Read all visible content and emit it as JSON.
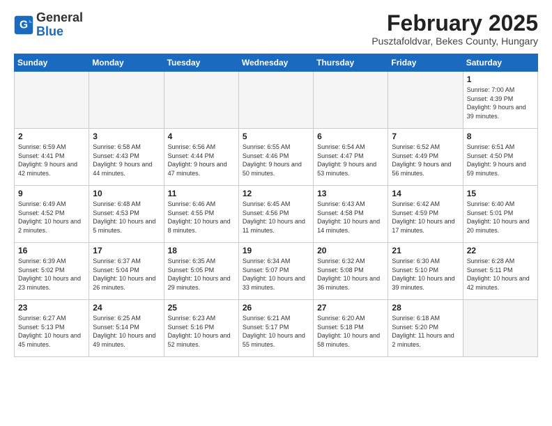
{
  "logo": {
    "general": "General",
    "blue": "Blue"
  },
  "title": "February 2025",
  "subtitle": "Pusztafoldvar, Bekes County, Hungary",
  "days_header": [
    "Sunday",
    "Monday",
    "Tuesday",
    "Wednesday",
    "Thursday",
    "Friday",
    "Saturday"
  ],
  "weeks": [
    [
      {
        "num": "",
        "info": ""
      },
      {
        "num": "",
        "info": ""
      },
      {
        "num": "",
        "info": ""
      },
      {
        "num": "",
        "info": ""
      },
      {
        "num": "",
        "info": ""
      },
      {
        "num": "",
        "info": ""
      },
      {
        "num": "1",
        "info": "Sunrise: 7:00 AM\nSunset: 4:39 PM\nDaylight: 9 hours and 39 minutes."
      }
    ],
    [
      {
        "num": "2",
        "info": "Sunrise: 6:59 AM\nSunset: 4:41 PM\nDaylight: 9 hours and 42 minutes."
      },
      {
        "num": "3",
        "info": "Sunrise: 6:58 AM\nSunset: 4:43 PM\nDaylight: 9 hours and 44 minutes."
      },
      {
        "num": "4",
        "info": "Sunrise: 6:56 AM\nSunset: 4:44 PM\nDaylight: 9 hours and 47 minutes."
      },
      {
        "num": "5",
        "info": "Sunrise: 6:55 AM\nSunset: 4:46 PM\nDaylight: 9 hours and 50 minutes."
      },
      {
        "num": "6",
        "info": "Sunrise: 6:54 AM\nSunset: 4:47 PM\nDaylight: 9 hours and 53 minutes."
      },
      {
        "num": "7",
        "info": "Sunrise: 6:52 AM\nSunset: 4:49 PM\nDaylight: 9 hours and 56 minutes."
      },
      {
        "num": "8",
        "info": "Sunrise: 6:51 AM\nSunset: 4:50 PM\nDaylight: 9 hours and 59 minutes."
      }
    ],
    [
      {
        "num": "9",
        "info": "Sunrise: 6:49 AM\nSunset: 4:52 PM\nDaylight: 10 hours and 2 minutes."
      },
      {
        "num": "10",
        "info": "Sunrise: 6:48 AM\nSunset: 4:53 PM\nDaylight: 10 hours and 5 minutes."
      },
      {
        "num": "11",
        "info": "Sunrise: 6:46 AM\nSunset: 4:55 PM\nDaylight: 10 hours and 8 minutes."
      },
      {
        "num": "12",
        "info": "Sunrise: 6:45 AM\nSunset: 4:56 PM\nDaylight: 10 hours and 11 minutes."
      },
      {
        "num": "13",
        "info": "Sunrise: 6:43 AM\nSunset: 4:58 PM\nDaylight: 10 hours and 14 minutes."
      },
      {
        "num": "14",
        "info": "Sunrise: 6:42 AM\nSunset: 4:59 PM\nDaylight: 10 hours and 17 minutes."
      },
      {
        "num": "15",
        "info": "Sunrise: 6:40 AM\nSunset: 5:01 PM\nDaylight: 10 hours and 20 minutes."
      }
    ],
    [
      {
        "num": "16",
        "info": "Sunrise: 6:39 AM\nSunset: 5:02 PM\nDaylight: 10 hours and 23 minutes."
      },
      {
        "num": "17",
        "info": "Sunrise: 6:37 AM\nSunset: 5:04 PM\nDaylight: 10 hours and 26 minutes."
      },
      {
        "num": "18",
        "info": "Sunrise: 6:35 AM\nSunset: 5:05 PM\nDaylight: 10 hours and 29 minutes."
      },
      {
        "num": "19",
        "info": "Sunrise: 6:34 AM\nSunset: 5:07 PM\nDaylight: 10 hours and 33 minutes."
      },
      {
        "num": "20",
        "info": "Sunrise: 6:32 AM\nSunset: 5:08 PM\nDaylight: 10 hours and 36 minutes."
      },
      {
        "num": "21",
        "info": "Sunrise: 6:30 AM\nSunset: 5:10 PM\nDaylight: 10 hours and 39 minutes."
      },
      {
        "num": "22",
        "info": "Sunrise: 6:28 AM\nSunset: 5:11 PM\nDaylight: 10 hours and 42 minutes."
      }
    ],
    [
      {
        "num": "23",
        "info": "Sunrise: 6:27 AM\nSunset: 5:13 PM\nDaylight: 10 hours and 45 minutes."
      },
      {
        "num": "24",
        "info": "Sunrise: 6:25 AM\nSunset: 5:14 PM\nDaylight: 10 hours and 49 minutes."
      },
      {
        "num": "25",
        "info": "Sunrise: 6:23 AM\nSunset: 5:16 PM\nDaylight: 10 hours and 52 minutes."
      },
      {
        "num": "26",
        "info": "Sunrise: 6:21 AM\nSunset: 5:17 PM\nDaylight: 10 hours and 55 minutes."
      },
      {
        "num": "27",
        "info": "Sunrise: 6:20 AM\nSunset: 5:18 PM\nDaylight: 10 hours and 58 minutes."
      },
      {
        "num": "28",
        "info": "Sunrise: 6:18 AM\nSunset: 5:20 PM\nDaylight: 11 hours and 2 minutes."
      },
      {
        "num": "",
        "info": ""
      }
    ]
  ]
}
